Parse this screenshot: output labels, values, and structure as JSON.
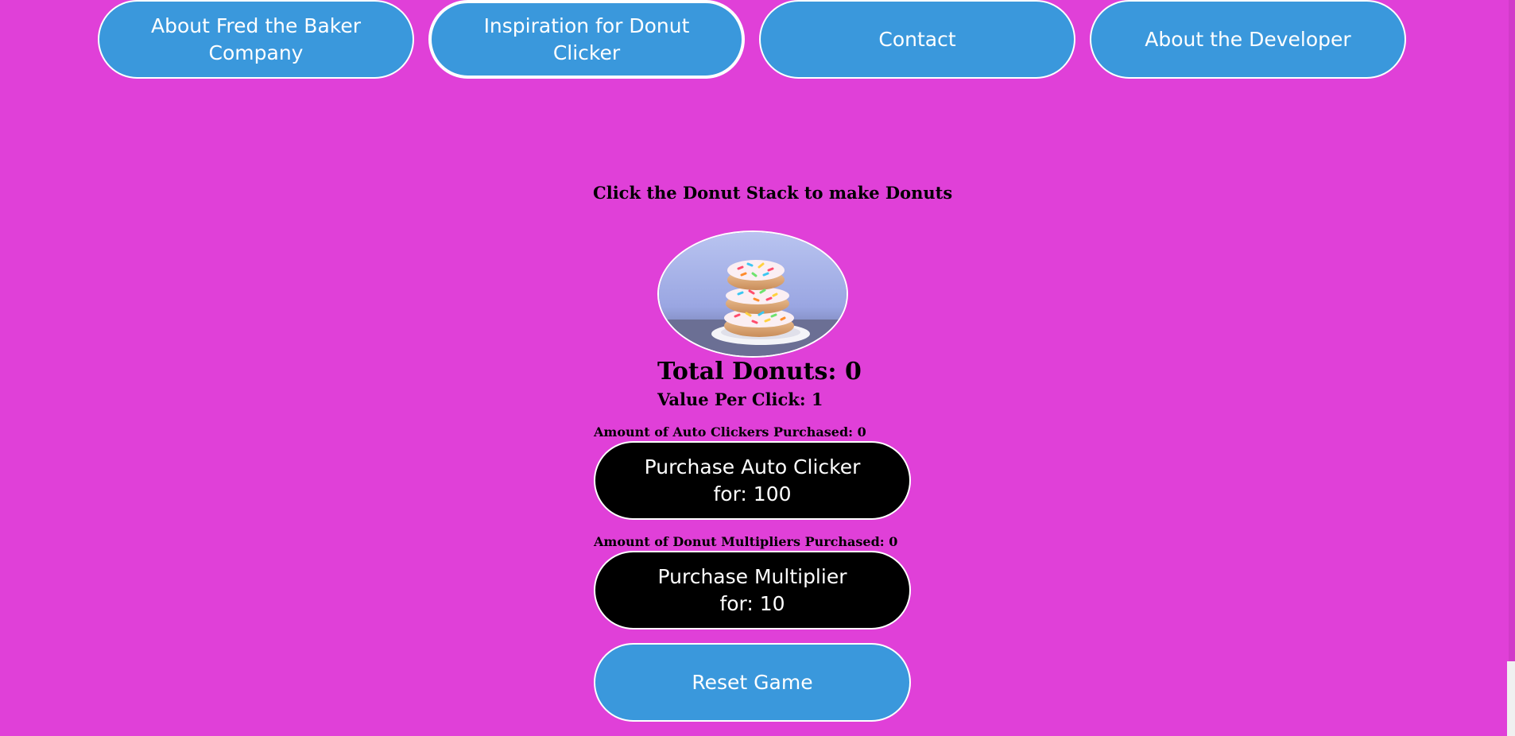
{
  "nav": {
    "items": [
      {
        "label": "About Fred the Baker Company"
      },
      {
        "label": "Inspiration for Donut Clicker"
      },
      {
        "label": "Contact"
      },
      {
        "label": "About the Developer"
      }
    ]
  },
  "game": {
    "instruction": "Click the Donut Stack to make Donuts",
    "donut_image_label": "donut-stack",
    "total_donuts": "Total Donuts: 0",
    "value_per_click": "Value Per Click: 1",
    "auto_clickers_count": "Amount of Auto Clickers Purchased: 0",
    "purchase_auto_clicker": "Purchase Auto Clicker for: 100",
    "multipliers_count": "Amount of Donut Multipliers Purchased: 0",
    "purchase_multiplier": "Purchase Multiplier for: 10",
    "reset": "Reset Game"
  },
  "colors": {
    "background": "#e040d8",
    "nav_button": "#3a98dc",
    "purchase_button": "#000000",
    "reset_button": "#3a98dc"
  }
}
